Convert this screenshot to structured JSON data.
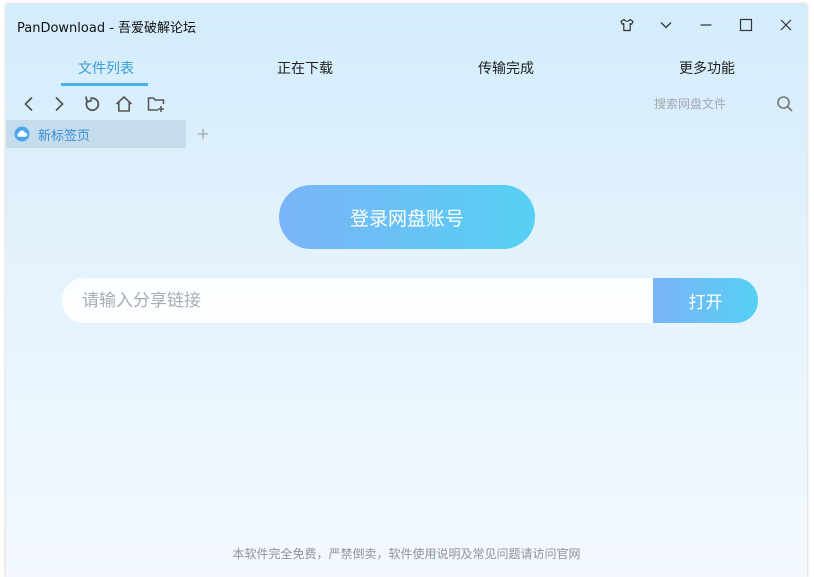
{
  "window": {
    "title": "PanDownload - 吾爱破解论坛"
  },
  "titlebar_icons": [
    "shirt-skin-icon",
    "chevron-down-icon",
    "minimize-icon",
    "maximize-icon",
    "close-icon"
  ],
  "tabs": [
    {
      "label": "文件列表",
      "active": true
    },
    {
      "label": "正在下载",
      "active": false
    },
    {
      "label": "传输完成",
      "active": false
    },
    {
      "label": "更多功能",
      "active": false
    }
  ],
  "toolbar": {
    "icons": [
      "back-icon",
      "forward-icon",
      "refresh-icon",
      "home-icon",
      "new-folder-icon"
    ],
    "search": {
      "placeholder": "搜索网盘文件",
      "value": ""
    }
  },
  "browser_tabs": [
    {
      "label": "新标签页",
      "icon": "cloud-icon"
    }
  ],
  "main": {
    "login_label": "登录网盘账号",
    "share": {
      "placeholder": "请输入分享链接",
      "value": "",
      "open_label": "打开"
    }
  },
  "footer": {
    "text": "本软件完全免费，严禁倒卖，软件使用说明及常见问题请访问官网"
  },
  "colors": {
    "accent": "#4ab0ee",
    "gradient_start": "#7ab4f8",
    "gradient_end": "#56d0f4"
  }
}
